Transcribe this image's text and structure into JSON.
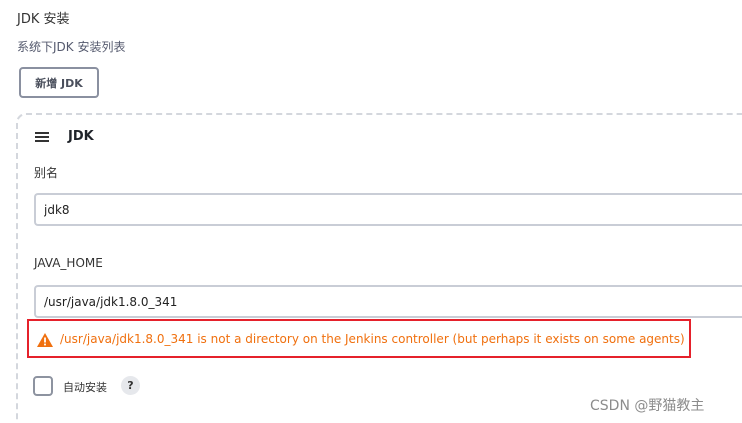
{
  "section": {
    "title": "JDK 安装",
    "description": "系统下JDK 安装列表",
    "add_button_label": "新增 JDK"
  },
  "jdk_card": {
    "title": "JDK",
    "alias_label": "别名",
    "alias_value": "jdk8",
    "java_home_label": "JAVA_HOME",
    "java_home_value": "/usr/java/jdk1.8.0_341",
    "warning_text": "/usr/java/jdk1.8.0_341 is not a directory on the Jenkins controller (but perhaps it exists on some agents)",
    "auto_install_label": "自动安装",
    "auto_install_checked": false,
    "help_label": "?"
  },
  "icons": {
    "drag": "drag-handle-icon",
    "warning": "warning-icon"
  },
  "colors": {
    "warning_text": "#f0700f",
    "highlight_border": "#e5212b"
  },
  "watermark": "CSDN @野猫教主"
}
